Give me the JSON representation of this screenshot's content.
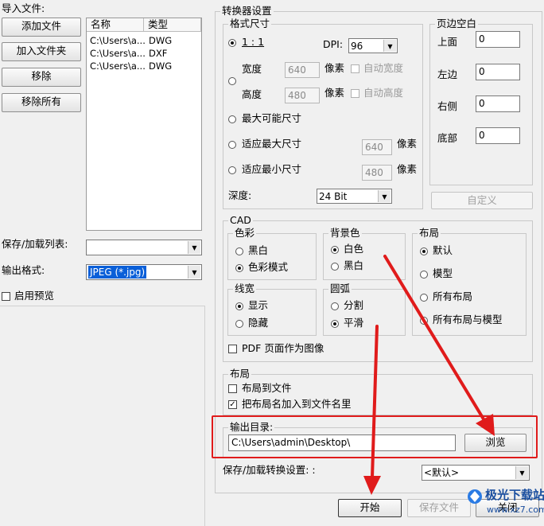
{
  "import": {
    "title": "导入文件:",
    "add_file": "添加文件",
    "add_folder": "加入文件夹",
    "remove": "移除",
    "remove_all": "移除所有",
    "columns": [
      "名称",
      "类型"
    ],
    "files": [
      {
        "name": "C:\\Users\\a...",
        "type": "DWG"
      },
      {
        "name": "C:\\Users\\a...",
        "type": "DXF"
      },
      {
        "name": "C:\\Users\\a...",
        "type": "DWG"
      }
    ],
    "save_load_list_label": "保存/加载列表:",
    "save_load_list_value": "",
    "output_format_label": "输出格式:",
    "output_format_value": "JPEG (*.jpg)",
    "enable_preview": "启用预览",
    "enable_preview_checked": false
  },
  "converter": {
    "title": "转换器设置",
    "format_size": {
      "title": "格式尺寸",
      "ratio_label": "1 : 1",
      "dpi_label": "DPI:",
      "dpi_value": "96",
      "width_label": "宽度",
      "width_value": "640",
      "height_label": "高度",
      "height_value": "480",
      "pixels": "像素",
      "auto_width": "自动宽度",
      "auto_height": "自动高度",
      "max_possible": "最大可能尺寸",
      "fit_max": "适应最大尺寸",
      "fit_max_value": "640",
      "fit_min": "适应最小尺寸",
      "fit_min_value": "480",
      "depth_label": "深度:",
      "depth_value": "24 Bit"
    },
    "margins": {
      "title": "页边空白",
      "top_label": "上面",
      "top_value": "0",
      "left_label": "左边",
      "left_value": "0",
      "right_label": "右侧",
      "right_value": "0",
      "bottom_label": "底部",
      "bottom_value": "0",
      "custom": "自定义"
    },
    "cad": {
      "title": "CAD",
      "color": {
        "title": "色彩",
        "options": [
          "黑白",
          "色彩模式"
        ],
        "selected": 1
      },
      "background": {
        "title": "背景色",
        "options": [
          "白色",
          "黑白"
        ],
        "selected": 0
      },
      "layout": {
        "title": "布局",
        "options": [
          "默认",
          "模型",
          "所有布局",
          "所有布局与模型"
        ],
        "selected": 0
      },
      "linewidth": {
        "title": "线宽",
        "options": [
          "显示",
          "隐藏"
        ],
        "selected": 0
      },
      "arc": {
        "title": "圆弧",
        "options": [
          "分割",
          "平滑"
        ],
        "selected": 1
      },
      "pdf_as_image": "PDF 页面作为图像"
    },
    "layout_group": {
      "title": "布局",
      "layout_to_file": "布局到文件",
      "layout_to_file_checked": false,
      "add_layout_name": "把布局名加入到文件名里",
      "add_layout_name_checked": true
    },
    "output": {
      "dir_label": "输出目录:",
      "dir_value": "C:\\Users\\admin\\Desktop\\",
      "browse": "浏览",
      "save_load_label": "保存/加载转换设置: :",
      "save_load_value": "<默认>"
    }
  },
  "footer": {
    "start": "开始",
    "save_file": "保存文件",
    "close": "关闭"
  },
  "watermark": {
    "text": "极光下载站",
    "url": "www.xz7.com"
  },
  "colors": {
    "highlight": "#e01b1b",
    "selection": "#0a5fd8"
  }
}
